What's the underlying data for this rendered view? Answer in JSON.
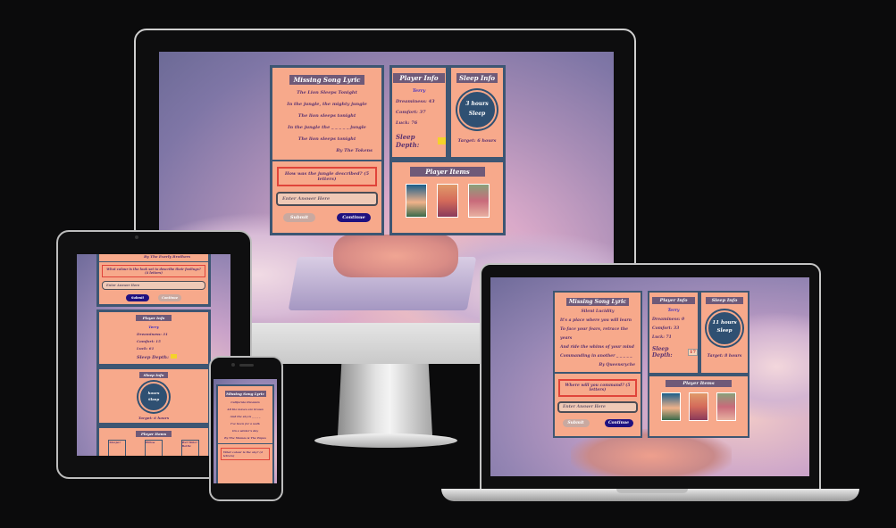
{
  "desktop": {
    "lyric_panel": {
      "title": "Missing Song Lyric",
      "song": "The Lion Sleeps Tonight",
      "lines": [
        "In the jungle, the mighty jungle",
        "The lion sleeps tonight",
        "In the jungle the _ _ _ _ _ jungle",
        "The lion sleeps tonight"
      ],
      "artist": "By The Tokens",
      "question": "How was the jungle described? (5 letters)",
      "input_placeholder": "Enter Answer Here",
      "submit_label": "Submit",
      "continue_label": "Continue"
    },
    "player_info": {
      "title": "Player Info",
      "name": "Terry",
      "dreaminess": "Dreaminess: 43",
      "comfort": "Comfort: 37",
      "luck": "Luck: 76",
      "sleep_depth_label": "Sleep Depth:",
      "sleep_depth_value": ""
    },
    "sleep_info": {
      "title": "Sleep Info",
      "hours": "3 hours",
      "sleep": "Sleep",
      "target": "Target: 6 hours"
    },
    "player_items": {
      "title": "Player Items"
    }
  },
  "laptop": {
    "lyric_panel": {
      "title": "Missing Song Lyric",
      "song": "Silent Lucidity",
      "lines": [
        "It's a place where you will learn",
        "To face your fears, retrace the years",
        "And ride the whims of your mind",
        "Commanding in another _ _ _ _ _"
      ],
      "artist": "By Queensryche",
      "question": "Where will you command? (5 letters)",
      "input_placeholder": "Enter Answer Here",
      "submit_label": "Submit",
      "continue_label": "Continue"
    },
    "player_info": {
      "title": "Player Info",
      "name": "Terry",
      "dreaminess": "Dreaminess: 0",
      "comfort": "Comfort: 33",
      "luck": "Luck: 71",
      "sleep_depth_label": "Sleep Depth:",
      "sleep_depth_value": "17"
    },
    "sleep_info": {
      "title": "Sleep Info",
      "hours": "11 hours",
      "sleep": "Sleep",
      "target": "Target: 8 hours"
    },
    "player_items": {
      "title": "Player Items"
    }
  },
  "tablet": {
    "artist": "By The Everly Brothers",
    "question": "What colour is the look set to describe their feelings? (4 letters)",
    "input_placeholder": "Enter Answer Here",
    "submit_label": "Submit",
    "continue_label": "Continue",
    "player_title": "Player Info",
    "name": "Terry",
    "dreaminess": "Dreaminess: 31",
    "comfort": "Comfort: 15",
    "luck": "Luck: 61",
    "sleep_depth_label": "Sleep Depth:",
    "sleep_title": "Sleep Info",
    "hours": "hours",
    "sleep": "Sleep",
    "target": "Target: 6 hours",
    "items_title": "Player Items",
    "items": [
      "Sleeper",
      "Pillow",
      "Wet Water Bottle"
    ]
  },
  "phone": {
    "title": "Missing Song Lyric",
    "song": "California Dreamin",
    "lines": [
      "All the leaves are brown",
      "And the sky is _ _ _ _",
      "I've been for a walk",
      "On a winter's day"
    ],
    "artist": "By The Mamas & The Papas",
    "question": "What colour is the sky? (4 letters)"
  },
  "colors": {
    "panel": "#f7a98b",
    "border": "#3d5673",
    "title_bg": "#6f5a78",
    "continue": "#1f1180",
    "highlight": "#e0443a"
  }
}
